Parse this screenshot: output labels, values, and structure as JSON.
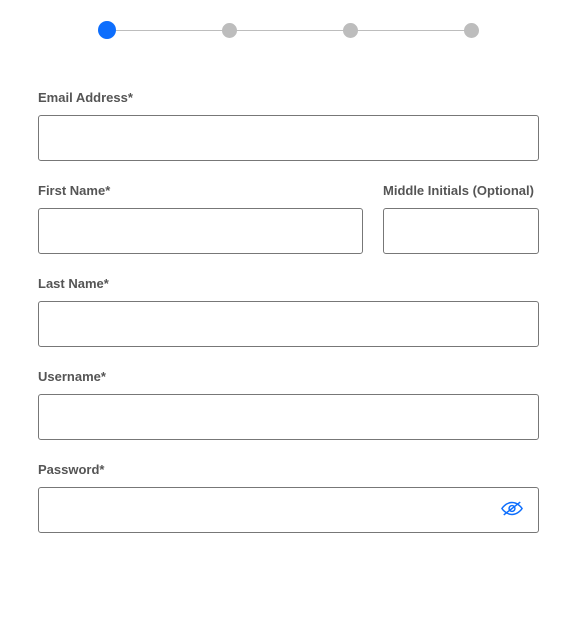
{
  "stepper": {
    "steps": 4,
    "current": 1
  },
  "fields": {
    "email": {
      "label": "Email Address*",
      "value": ""
    },
    "first_name": {
      "label": "First Name*",
      "value": ""
    },
    "middle_initials": {
      "label": "Middle Initials (Optional)",
      "value": ""
    },
    "last_name": {
      "label": "Last Name*",
      "value": ""
    },
    "username": {
      "label": "Username*",
      "value": ""
    },
    "password": {
      "label": "Password*",
      "value": ""
    }
  }
}
